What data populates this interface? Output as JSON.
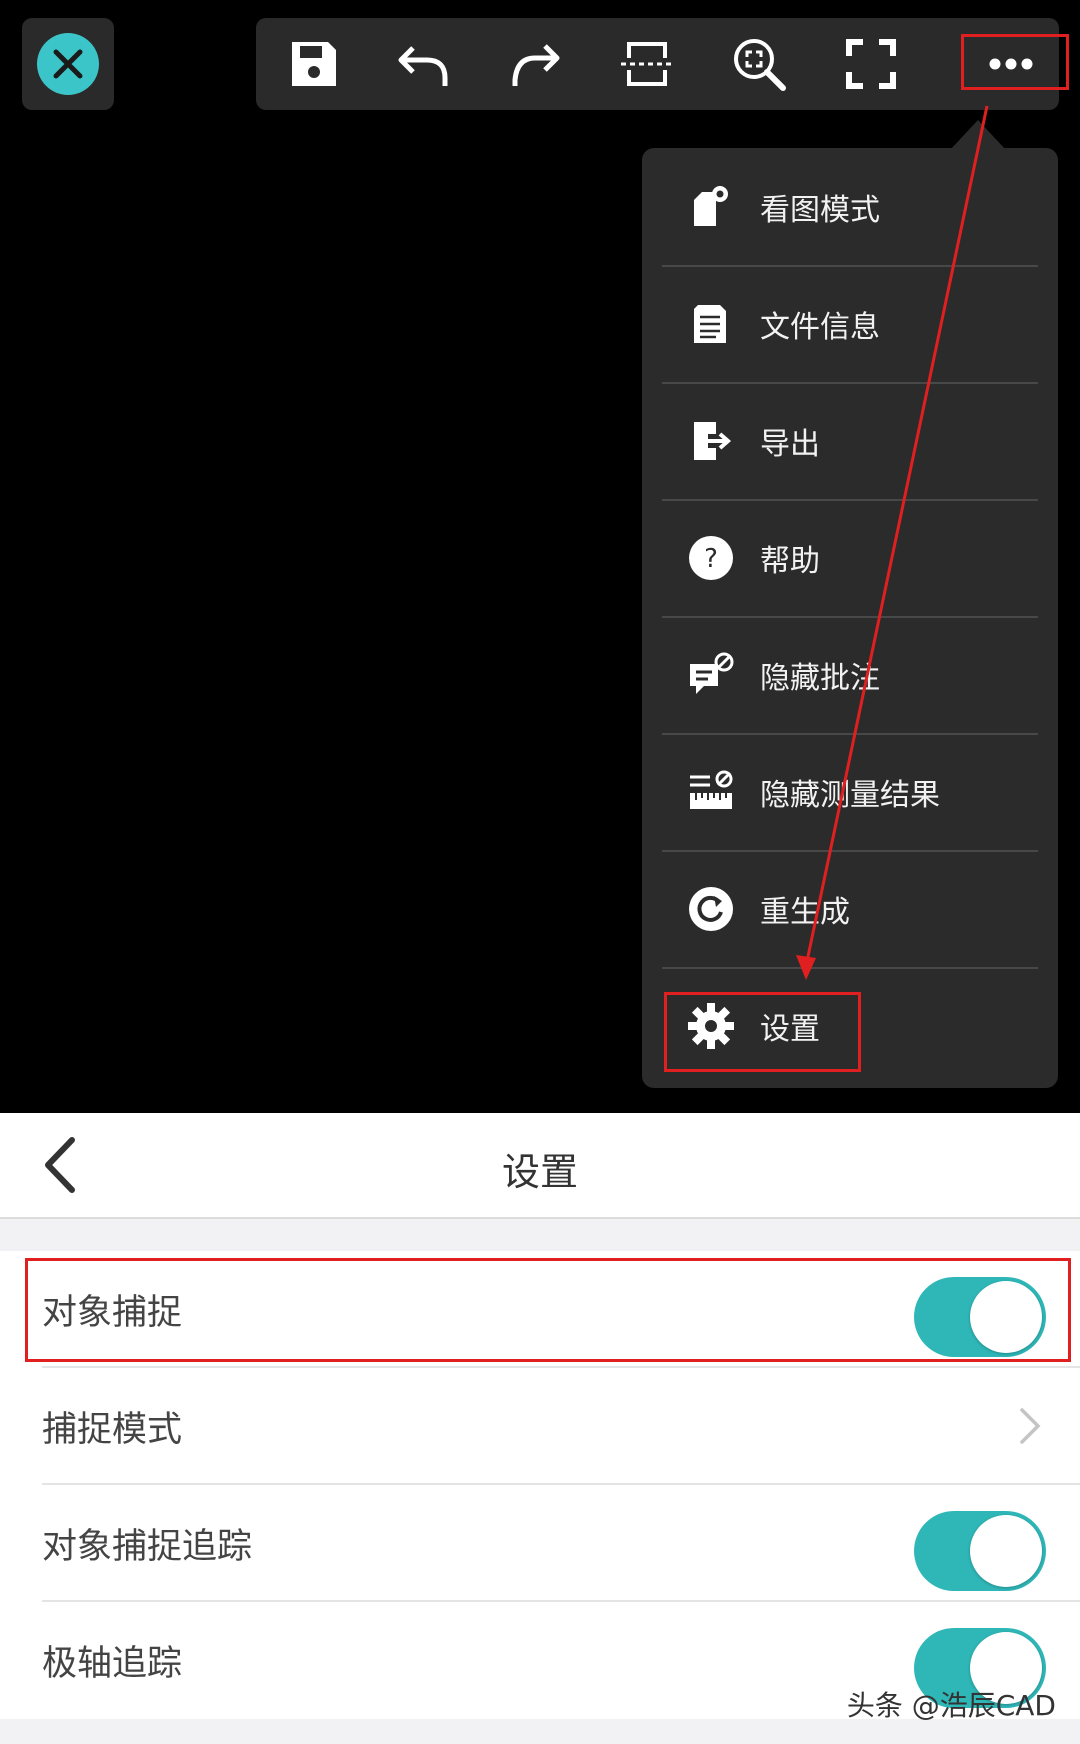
{
  "toolbar": {
    "buttons": [
      {
        "name": "save-icon"
      },
      {
        "name": "undo-icon"
      },
      {
        "name": "redo-icon"
      },
      {
        "name": "crop-icon"
      },
      {
        "name": "zoom-fit-icon"
      },
      {
        "name": "fullscreen-icon"
      },
      {
        "name": "more-icon"
      }
    ],
    "accent": "#3cc5c9"
  },
  "menu": {
    "items": [
      {
        "label": "看图模式",
        "icon": "view-mode-icon"
      },
      {
        "label": "文件信息",
        "icon": "file-info-icon"
      },
      {
        "label": "导出",
        "icon": "export-icon"
      },
      {
        "label": "帮助",
        "icon": "help-icon"
      },
      {
        "label": "隐藏批注",
        "icon": "hide-annotation-icon"
      },
      {
        "label": "隐藏测量结果",
        "icon": "hide-measure-icon"
      },
      {
        "label": "重生成",
        "icon": "regenerate-icon"
      },
      {
        "label": "设置",
        "icon": "gear-icon"
      }
    ]
  },
  "settings": {
    "title": "设置",
    "rows": [
      {
        "label": "对象捕捉",
        "type": "toggle",
        "on": true
      },
      {
        "label": "捕捉模式",
        "type": "link"
      },
      {
        "label": "对象捕捉追踪",
        "type": "toggle",
        "on": true
      },
      {
        "label": "极轴追踪",
        "type": "toggle",
        "on": true
      }
    ]
  },
  "watermark": "头条 @浩辰CAD",
  "colors": {
    "highlight": "#e02020",
    "toggle_on": "#2fb7b8"
  }
}
